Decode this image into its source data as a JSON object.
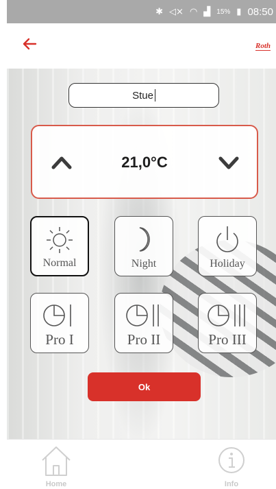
{
  "status_bar": {
    "icons": [
      "bluetooth-icon",
      "mute-icon",
      "wifi-icon",
      "signal-icon",
      "battery-icon"
    ],
    "battery": "15%",
    "time": "08:50"
  },
  "header": {
    "back_icon": "arrow-left-icon",
    "brand_logo": "Roth"
  },
  "room": {
    "name": "Stue"
  },
  "temperature": {
    "value": "21,0°C",
    "up_icon": "chevron-up-icon",
    "down_icon": "chevron-down-icon"
  },
  "modes": [
    {
      "label": "Normal",
      "icon": "sun-icon",
      "selected": true
    },
    {
      "label": "Night",
      "icon": "moon-icon",
      "selected": false
    },
    {
      "label": "Holiday",
      "icon": "power-icon",
      "selected": false
    },
    {
      "label": "Pro I",
      "icon": "clock-program-1-icon",
      "selected": false
    },
    {
      "label": "Pro II",
      "icon": "clock-program-2-icon",
      "selected": false
    },
    {
      "label": "Pro III",
      "icon": "clock-program-3-icon",
      "selected": false
    }
  ],
  "ok_button": {
    "label": "Ok"
  },
  "bottom_nav": {
    "home_label": "Home",
    "info_label": "Info"
  },
  "colors": {
    "accent": "#d8312a",
    "panel_border": "#d85a4a",
    "status_bar": "#a9a9a9"
  }
}
